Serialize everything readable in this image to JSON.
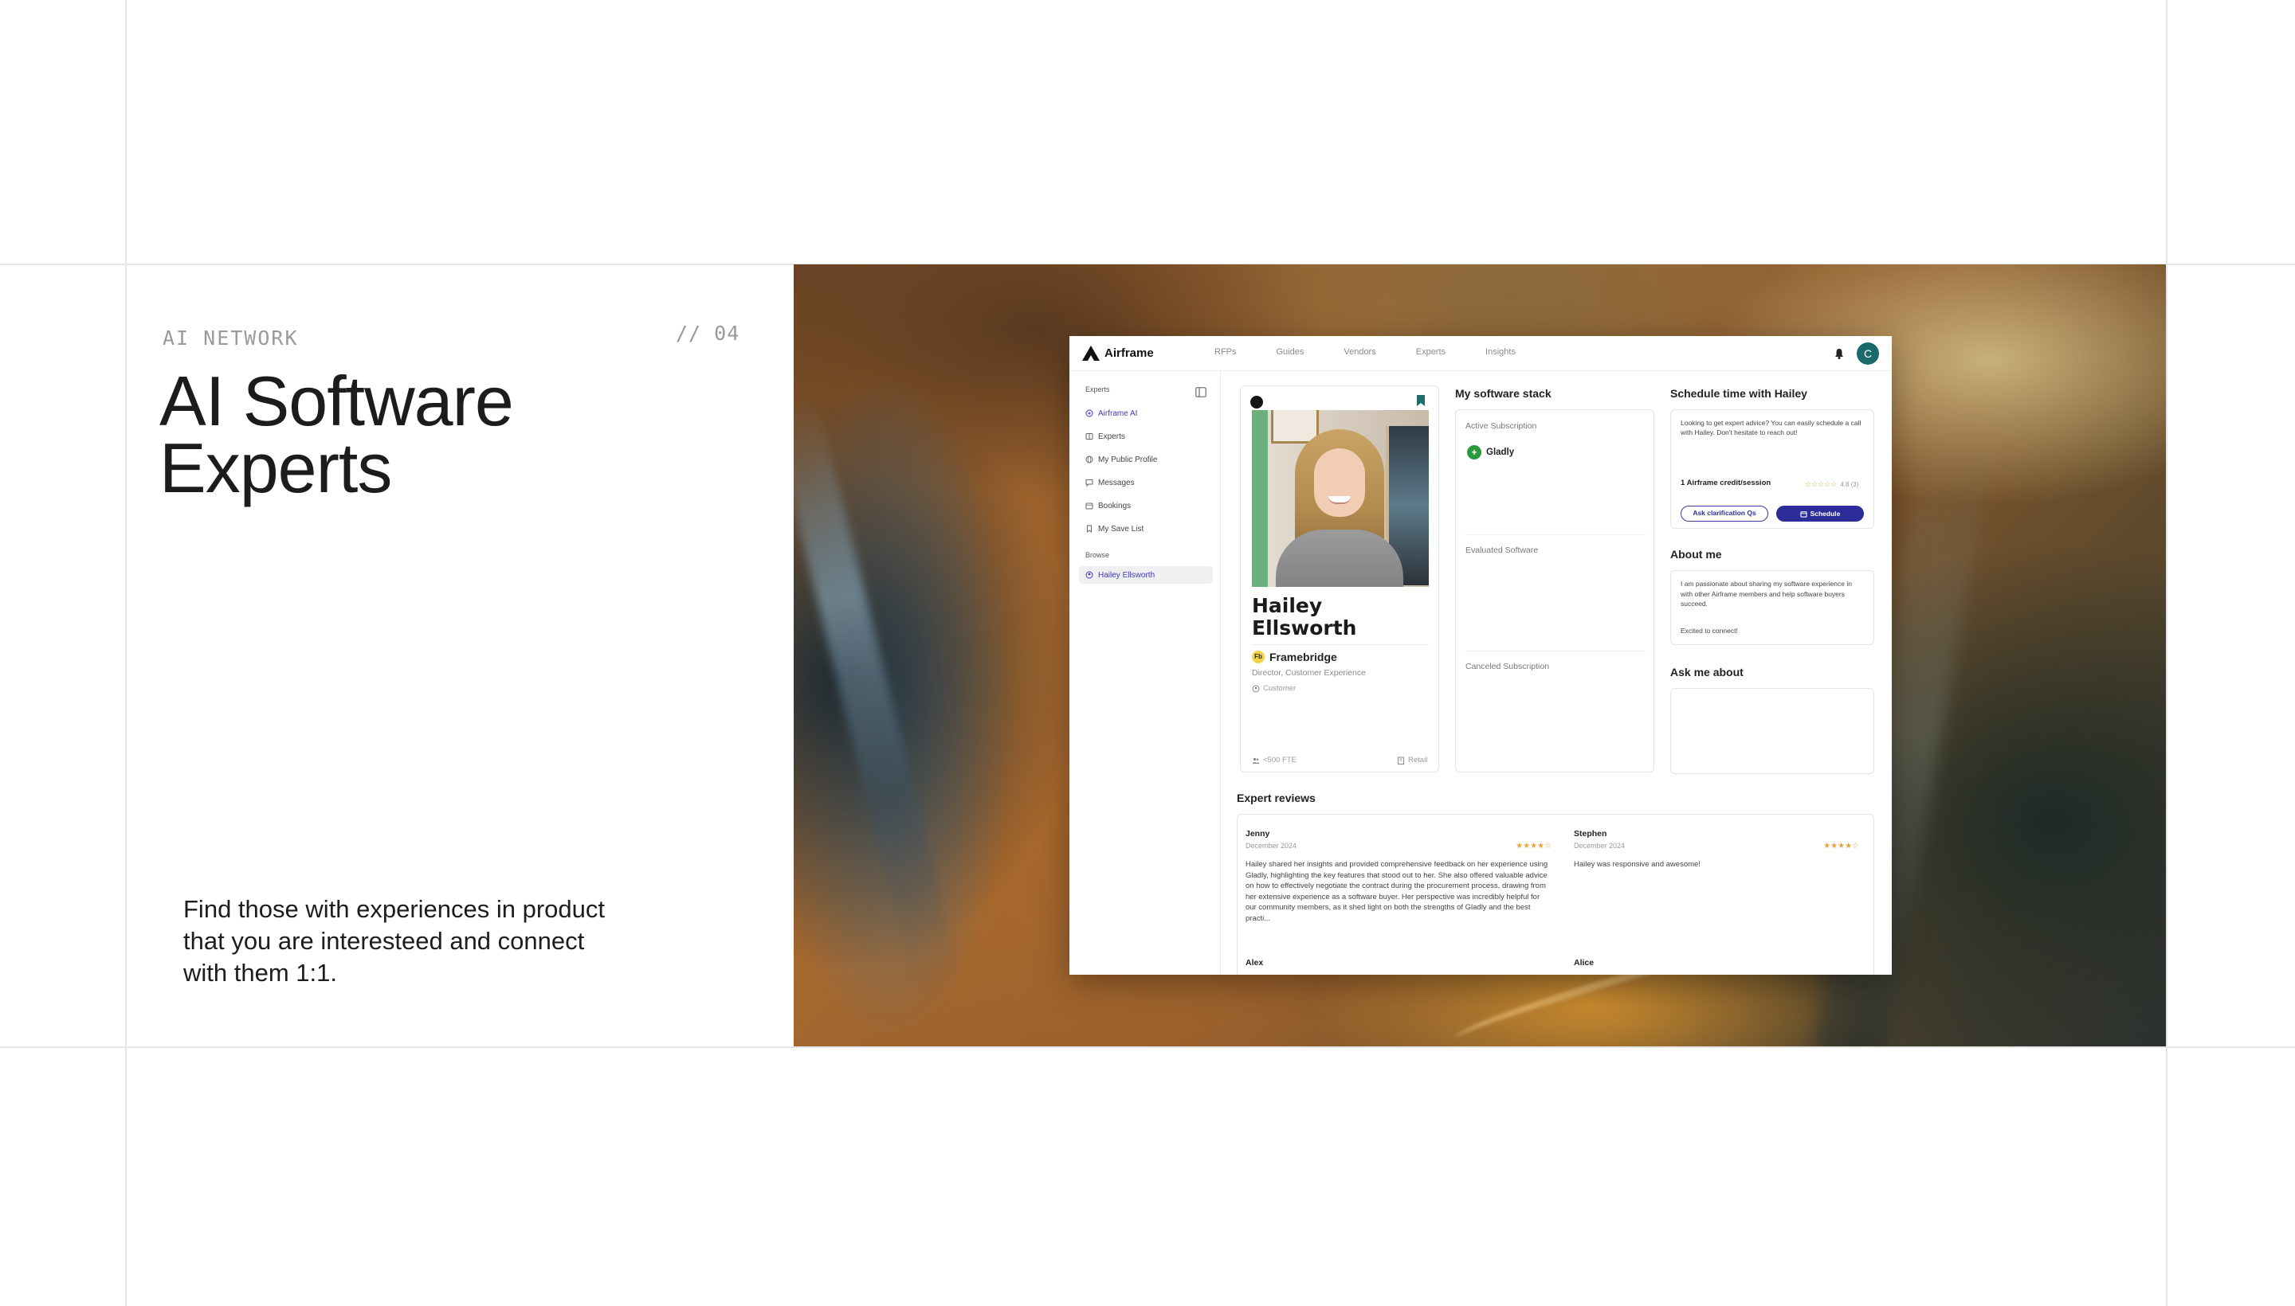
{
  "slide": {
    "eyebrow": "AI NETWORK",
    "number": "// 04",
    "headline_line1": "AI Software",
    "headline_line2": "Experts",
    "body": "Find those with experiences in product that you are interesteed and connect with them 1:1."
  },
  "app": {
    "brand": "Airframe",
    "nav": [
      "RFPs",
      "Guides",
      "Vendors",
      "Experts",
      "Insights"
    ],
    "avatar_initial": "C",
    "accent_color": "#2b2b9a",
    "avatar_color": "#1a6a6a",
    "sidebar": {
      "heading_experts": "Experts",
      "items": [
        {
          "label": "Airframe AI",
          "icon": "sparkle-icon"
        },
        {
          "label": "Experts",
          "icon": "book-icon"
        },
        {
          "label": "My Public Profile",
          "icon": "globe-icon"
        },
        {
          "label": "Messages",
          "icon": "chat-icon"
        },
        {
          "label": "Bookings",
          "icon": "calendar-icon"
        },
        {
          "label": "My Save List",
          "icon": "bookmark-icon"
        }
      ],
      "heading_browse": "Browse",
      "browse_items": [
        {
          "label": "Hailey Ellsworth",
          "icon": "user-circle-icon"
        }
      ]
    },
    "profile": {
      "name": "Hailey Ellsworth",
      "company": "Framebridge",
      "company_logo_text": "Fb",
      "title": "Director, Customer Experience",
      "type": "Customer",
      "company_size": "<500 FTE",
      "industry": "Retail"
    },
    "stack": {
      "title": "My software stack",
      "active_label": "Active Subscription",
      "active_items": [
        "Gladly"
      ],
      "evaluated_label": "Evaluated Software",
      "canceled_label": "Canceled Subscription"
    },
    "schedule": {
      "title": "Schedule time with Hailey",
      "text": "Looking to get expert advice? You can easily schedule a call with Hailey. Don't hesitate to reach out!",
      "credit": "1 Airframe credit/session",
      "stars": "☆☆☆☆☆",
      "rating": "4.8 (3)",
      "ask_button": "Ask clarification Qs",
      "schedule_button": "Schedule"
    },
    "about": {
      "title": "About me",
      "text": "I am passionate about sharing my software experience in with other Airframe members and help software buyers succeed.",
      "sign_off": "Excited to connect!"
    },
    "ask_me_about": {
      "title": "Ask me about"
    },
    "reviews": {
      "title": "Expert reviews",
      "items": [
        {
          "name": "Jenny",
          "date": "December 2024",
          "stars": "★★★★☆",
          "text": "Hailey shared her insights and provided comprehensive feedback on her experience using Gladly, highlighting the key features that stood out to her. She also offered valuable advice on how to effectively negotiate the contract during the procurement process, drawing from her extensive experience as a software buyer. Her perspective was incredibly helpful for our community members, as it shed light on both the strengths of Gladly and the best practi..."
        },
        {
          "name": "Stephen",
          "date": "December 2024",
          "stars": "★★★★☆",
          "text": "Hailey was responsive and awesome!"
        },
        {
          "name": "Alex"
        },
        {
          "name": "Alice"
        }
      ]
    }
  }
}
